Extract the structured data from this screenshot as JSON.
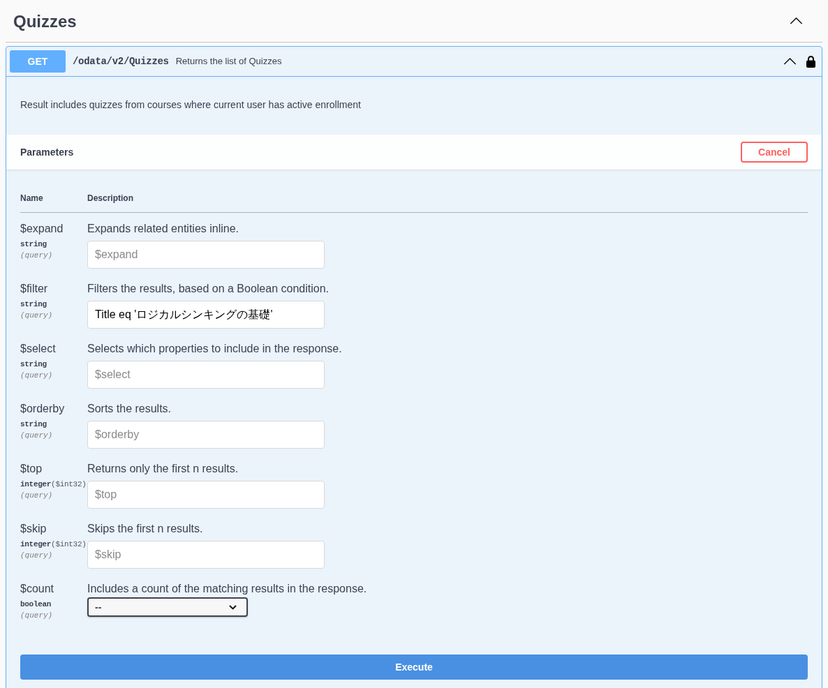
{
  "section": {
    "title": "Quizzes",
    "expanded": true
  },
  "operation": {
    "method": "GET",
    "path": "/odata/v2/Quizzes",
    "summary": "Returns the list of Quizzes",
    "expanded": true,
    "locked": true,
    "description": "Result includes quizzes from courses where current user has active enrollment"
  },
  "parameters": {
    "title": "Parameters",
    "cancel_button": "Cancel",
    "columns": [
      "Name",
      "Description"
    ],
    "rows": [
      {
        "name": "$expand",
        "type": "string",
        "in": "(query)",
        "description": "Expands related entities inline.",
        "kind": "text",
        "placeholder": "$expand"
      },
      {
        "name": "$filter",
        "type": "string",
        "in": "(query)",
        "description": "Filters the results, based on a Boolean condition.",
        "kind": "text",
        "value": "Title eq 'ロジカルシンキングの基礎'"
      },
      {
        "name": "$select",
        "type": "string",
        "in": "(query)",
        "description": "Selects which properties to include in the response.",
        "kind": "text",
        "placeholder": "$select"
      },
      {
        "name": "$orderby",
        "type": "string",
        "in": "(query)",
        "description": "Sorts the results.",
        "kind": "text",
        "placeholder": "$orderby"
      },
      {
        "name": "$top",
        "type": "integer",
        "format": "($int32)",
        "in": "(query)",
        "description": "Returns only the first n results.",
        "kind": "text",
        "placeholder": "$top"
      },
      {
        "name": "$skip",
        "type": "integer",
        "format": "($int32)",
        "in": "(query)",
        "description": "Skips the first n results.",
        "kind": "text",
        "placeholder": "$skip"
      },
      {
        "name": "$count",
        "type": "boolean",
        "in": "(query)",
        "description": "Includes a count of the matching results in the response.",
        "kind": "select",
        "value": "--"
      }
    ]
  },
  "execute_button": "Execute"
}
